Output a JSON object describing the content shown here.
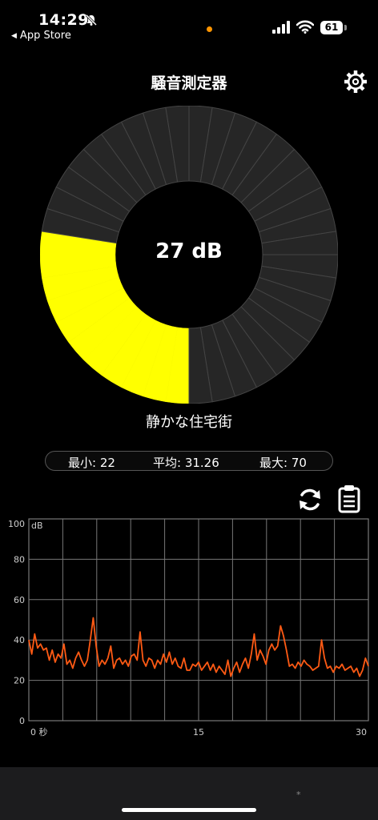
{
  "status_bar": {
    "time": "14:29",
    "back_label": "App Store",
    "battery": "61"
  },
  "header": {
    "title": "騒音測定器"
  },
  "gauge": {
    "value_label": "27 dB",
    "level": 27,
    "max": 100,
    "segments": 40,
    "description": "静かな住宅街",
    "filled_color": "#ffff00",
    "empty_color": "#262626"
  },
  "stats": {
    "min": "最小: 22",
    "avg": "平均: 31.26",
    "max": "最大: 70"
  },
  "chart_data": {
    "type": "line",
    "unit_label": "dB",
    "y_ticks": [
      "0",
      "20",
      "40",
      "60",
      "80",
      "100"
    ],
    "x_ticks": [
      "0 秒",
      "15",
      "30"
    ],
    "ylim": [
      0,
      100
    ],
    "xlim": [
      0,
      30
    ],
    "grid": true,
    "line_color": "#ff5a14",
    "series": [
      {
        "values": [
          40,
          33,
          43,
          36,
          38,
          35,
          36,
          30,
          35,
          29,
          33,
          31,
          38,
          28,
          30,
          26,
          31,
          34,
          30,
          27,
          30,
          40,
          51,
          37,
          27,
          30,
          28,
          31,
          37,
          26,
          30,
          31,
          28,
          30,
          27,
          32,
          33,
          30,
          44,
          30,
          27,
          31,
          30,
          26,
          30,
          28,
          33,
          29,
          34,
          28,
          31,
          27,
          26,
          31,
          25,
          25,
          28,
          27,
          29,
          25,
          27,
          29,
          25,
          28,
          24,
          27,
          25,
          23,
          30,
          22,
          26,
          29,
          24,
          28,
          31,
          26,
          33,
          43,
          30,
          35,
          32,
          28,
          35,
          38,
          35,
          37,
          47,
          42,
          35,
          27,
          28,
          26,
          29,
          27,
          30,
          28,
          27,
          25,
          26,
          27,
          40,
          31,
          26,
          27,
          24,
          27,
          26,
          28,
          25,
          26,
          27,
          24,
          26,
          22,
          25,
          31,
          27
        ]
      }
    ]
  }
}
